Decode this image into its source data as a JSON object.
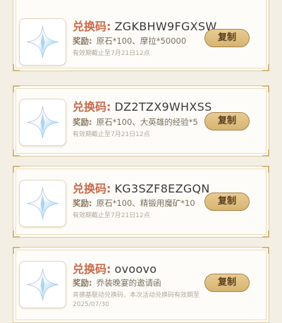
{
  "cards": [
    {
      "code_label": "兑换码:",
      "code": "ZGKBHW9FGXSW",
      "reward_label": "奖励:",
      "reward": "原石*100、摩拉*50000",
      "expiry": "有效期截止至7月21日12点",
      "copy_label": "复制"
    },
    {
      "code_label": "兑换码:",
      "code": "DZ2TZX9WHXSS",
      "reward_label": "奖励:",
      "reward": "原石*100、大英雄的经验*5",
      "expiry": "有效期截止至7月21日12点",
      "copy_label": "复制"
    },
    {
      "code_label": "兑换码:",
      "code": "KG3SZF8EZGQN",
      "reward_label": "奖励:",
      "reward": "原石*100、精锻用魔矿*10",
      "expiry": "有效期截止至7月21日12点",
      "copy_label": "复制"
    },
    {
      "code_label": "兑换码:",
      "code": "ovoovo",
      "reward_label": "奖励:",
      "reward": "乔装晚宴的邀请函",
      "expiry": "肯德基联动兑换码，本次活动兑换码有效期至2025/07/30",
      "copy_label": "复制"
    }
  ],
  "icon": "primogem-icon",
  "colors": {
    "accent": "#c9694a",
    "button": "#dcbc7c",
    "border": "#ddc9a0"
  }
}
